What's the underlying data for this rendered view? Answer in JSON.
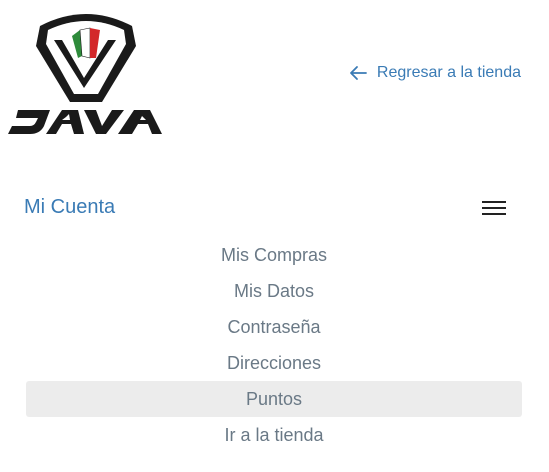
{
  "header": {
    "logo_icon": "java-shield-logo-icon",
    "logo_colors": [
      "#2e8b3b",
      "#ffffff",
      "#d3282a",
      "#1a1a1a"
    ],
    "back_icon": "arrow-left-icon",
    "back_label": "Regresar a la tienda"
  },
  "account": {
    "title": "Mi Cuenta",
    "menu_icon": "hamburger-menu-icon"
  },
  "nav": {
    "items": [
      {
        "label": "Mis Compras"
      },
      {
        "label": "Mis Datos"
      },
      {
        "label": "Contraseña"
      },
      {
        "label": "Direcciones"
      },
      {
        "label": "Puntos"
      },
      {
        "label": "Ir a la tienda"
      }
    ],
    "active_index": 4
  },
  "colors": {
    "link": "#3a7bb5",
    "nav_text": "#6a7986",
    "active_bg": "#ececec"
  }
}
